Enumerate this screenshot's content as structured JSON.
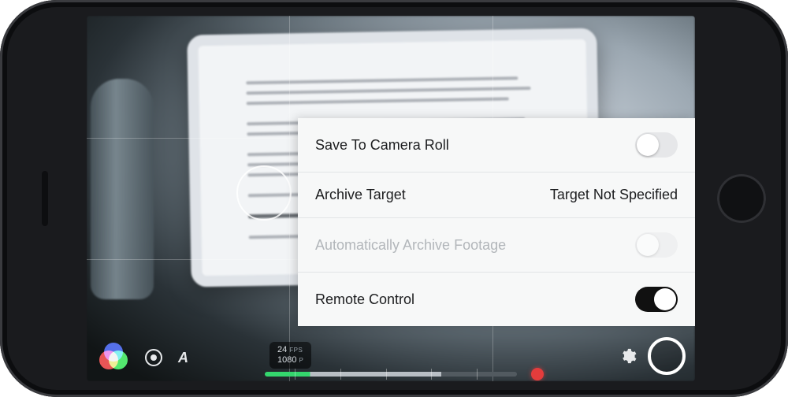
{
  "settings": {
    "rows": [
      {
        "label": "Save To Camera Roll"
      },
      {
        "label": "Archive Target",
        "value": "Target Not Specified"
      },
      {
        "label": "Automatically Archive Footage"
      },
      {
        "label": "Remote Control"
      }
    ]
  },
  "hud": {
    "fps_value": "24",
    "fps_unit": "FPS",
    "res_value": "1080",
    "res_unit": "P"
  }
}
